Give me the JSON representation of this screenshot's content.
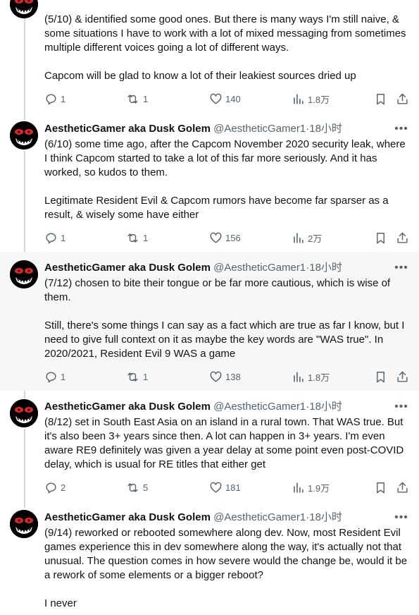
{
  "tweets": [
    {
      "text": "(5/10) & identified some good ones. But there is many ways I'm still naive, & some situations I have to work with a lot of mixed messaging from sometimes multiple different voices going a lot of different ways.\n\nCapcom will be glad to know a lot of their leakiest sources dried up",
      "replies": "1",
      "reposts": "1",
      "likes": "140",
      "views": "1.8万"
    },
    {
      "name": "AestheticGamer aka Dusk Golem",
      "handle": "@AestheticGamer1",
      "dot": "·",
      "time": "18小时",
      "text": "(6/10) some time ago, after the Capcom November 2020 security leak, where I think Capcom started to take a lot of this far more seriously. And it has worked, so kudos to them.\n\nLegitimate Resident Evil & Capcom rumors have become far sparser as a result, & wisely some have either",
      "replies": "1",
      "reposts": "1",
      "likes": "156",
      "views": "2万"
    },
    {
      "name": "AestheticGamer aka Dusk Golem",
      "handle": "@AestheticGamer1",
      "dot": "·",
      "time": "18小时",
      "text": "(7/12) chosen to bite their tongue or be far more cautious, which is wise of them.\n\nStill, there's some things I can say as a fact which are true as far I know, but I need to give full context on it as maybe the key words are \"WAS true\". In 2020/2021, Resident Evil 9 WAS a game",
      "replies": "1",
      "reposts": "1",
      "likes": "138",
      "views": "1.8万"
    },
    {
      "name": "AestheticGamer aka Dusk Golem",
      "handle": "@AestheticGamer1",
      "dot": "·",
      "time": "18小时",
      "text": "(8/12) set in South East Asia on an island in a rural town. That WAS true. But it's also been 3+ years since then. A lot can happen in 3+ years. I'm even aware RE9 definitely was given a year delay at some point even post-COVID delay, which is usual for RE titles that either get",
      "replies": "2",
      "reposts": "5",
      "likes": "181",
      "views": "1.9万"
    },
    {
      "name": "AestheticGamer aka Dusk Golem",
      "handle": "@AestheticGamer1",
      "dot": "·",
      "time": "18小时",
      "text": "(9/14) reworked or rebooted somewhere along dev. Now, most Resident Evil games experience this in dev somewhere along the way, it's actually not that unusual. The question comes in how severe would the change be, would it be a rework of some elements or a bigger reboot?\n\nI never"
    }
  ],
  "icons": {
    "avatar": "monster-face-avatar",
    "more": "more-horizontal-icon",
    "reply": "reply-icon",
    "repost": "repost-icon",
    "like": "heart-icon",
    "views": "analytics-icon",
    "bookmark": "bookmark-icon",
    "share": "share-icon"
  },
  "colors": {
    "text": "#0f1419",
    "secondary": "#536471",
    "thread_line": "#cfd9de",
    "highlight_bg": "#f7f7f7",
    "avatar_eyes": "#e3242b"
  }
}
